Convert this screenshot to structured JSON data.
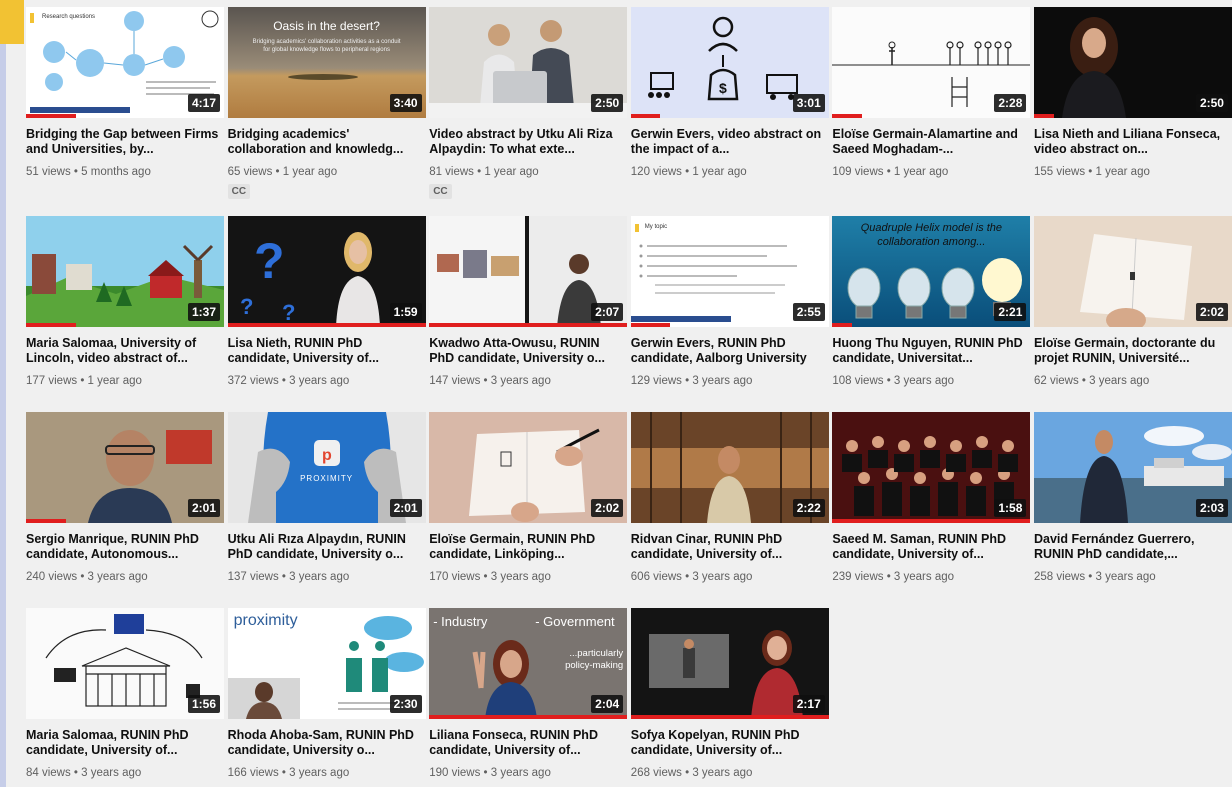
{
  "colors": {
    "progress": "#e01e1e",
    "frame_accent": "#f2c233",
    "frame_side": "#c6cde8"
  },
  "videos": [
    {
      "title": "Bridging the Gap between Firms and Universities, by...",
      "views": "51 views • 5 months ago",
      "duration": "4:17",
      "progress": 0.25,
      "thumb_text": [
        "Research questions"
      ]
    },
    {
      "title": "Bridging academics' collaboration and knowledg...",
      "views": "65 views • 1 year ago",
      "duration": "3:40",
      "badge": "CC",
      "thumb_text": [
        "Oasis in the desert?",
        "Bridging academics' collaboration activities as a conduit",
        "for global knowledge flows to peripheral regions"
      ]
    },
    {
      "title": "Video abstract by Utku Ali Riza Alpaydin: To what exte...",
      "views": "81 views • 1 year ago",
      "duration": "2:50",
      "badge": "CC"
    },
    {
      "title": "Gerwin Evers, video abstract on the impact of a...",
      "views": "120 views • 1 year ago",
      "duration": "3:01",
      "progress": 0.15
    },
    {
      "title": "Eloïse Germain-Alamartine and Saeed Moghadam-...",
      "views": "109 views • 1 year ago",
      "duration": "2:28",
      "progress": 0.15
    },
    {
      "title": "Lisa Nieth and Liliana Fonseca, video abstract on...",
      "views": "155 views • 1 year ago",
      "duration": "2:50",
      "progress": 0.1
    },
    {
      "title": "Maria Salomaa, University of Lincoln, video abstract of...",
      "views": "177 views • 1 year ago",
      "duration": "1:37",
      "progress": 0.25
    },
    {
      "title": "Lisa Nieth, RUNIN PhD candidate, University of...",
      "views": "372 views • 3 years ago",
      "duration": "1:59",
      "progress": 1.0
    },
    {
      "title": "Kwadwo Atta-Owusu, RUNIN PhD candidate, University o...",
      "views": "147 views • 3 years ago",
      "duration": "2:07",
      "progress": 1.0
    },
    {
      "title": "Gerwin Evers, RUNIN PhD candidate, Aalborg University",
      "views": "129 views • 3 years ago",
      "duration": "2:55",
      "progress": 0.2,
      "thumb_text": [
        "My topic"
      ]
    },
    {
      "title": "Huong Thu Nguyen, RUNIN PhD candidate, Universitat...",
      "views": "108 views • 3 years ago",
      "duration": "2:21",
      "progress": 0.1,
      "thumb_text": [
        "Quadruple Helix model is the",
        "collaboration among..."
      ]
    },
    {
      "title": "Eloïse Germain, doctorante du projet RUNIN, Université...",
      "views": "62 views • 3 years ago",
      "duration": "2:02"
    },
    {
      "title": "Sergio Manrique, RUNIN PhD candidate, Autonomous...",
      "views": "240 views • 3 years ago",
      "duration": "2:01",
      "progress": 0.2
    },
    {
      "title": "Utku Ali Rıza Alpaydın, RUNIN PhD candidate, University o...",
      "views": "137 views • 3 years ago",
      "duration": "2:01",
      "thumb_text": [
        "PROXIMITY"
      ]
    },
    {
      "title": "Eloïse Germain, RUNIN PhD candidate, Linköping...",
      "views": "170 views • 3 years ago",
      "duration": "2:02"
    },
    {
      "title": "Ridvan Cinar, RUNIN PhD candidate, University of...",
      "views": "606 views • 3 years ago",
      "duration": "2:22"
    },
    {
      "title": "Saeed M. Saman, RUNIN PhD candidate, University of...",
      "views": "239 views • 3 years ago",
      "duration": "1:58",
      "progress": 1.0
    },
    {
      "title": "David Fernández Guerrero, RUNIN PhD candidate,...",
      "views": "258 views • 3 years ago",
      "duration": "2:03"
    },
    {
      "title": "Maria Salomaa, RUNIN PhD candidate, University of...",
      "views": "84 views • 3 years ago",
      "duration": "1:56"
    },
    {
      "title": "Rhoda Ahoba-Sam, RUNIN PhD candidate, University o...",
      "views": "166 views • 3 years ago",
      "duration": "2:30",
      "thumb_text": [
        "proximity"
      ]
    },
    {
      "title": "Liliana Fonseca, RUNIN PhD candidate, University of...",
      "views": "190 views • 3 years ago",
      "duration": "2:04",
      "progress": 1.0,
      "thumb_text": [
        "- Industry",
        "- Government",
        "...particularly",
        "policy-making"
      ]
    },
    {
      "title": "Sofya Kopelyan, RUNIN PhD candidate, University of...",
      "views": "268 views • 3 years ago",
      "duration": "2:17",
      "progress": 1.0
    }
  ]
}
